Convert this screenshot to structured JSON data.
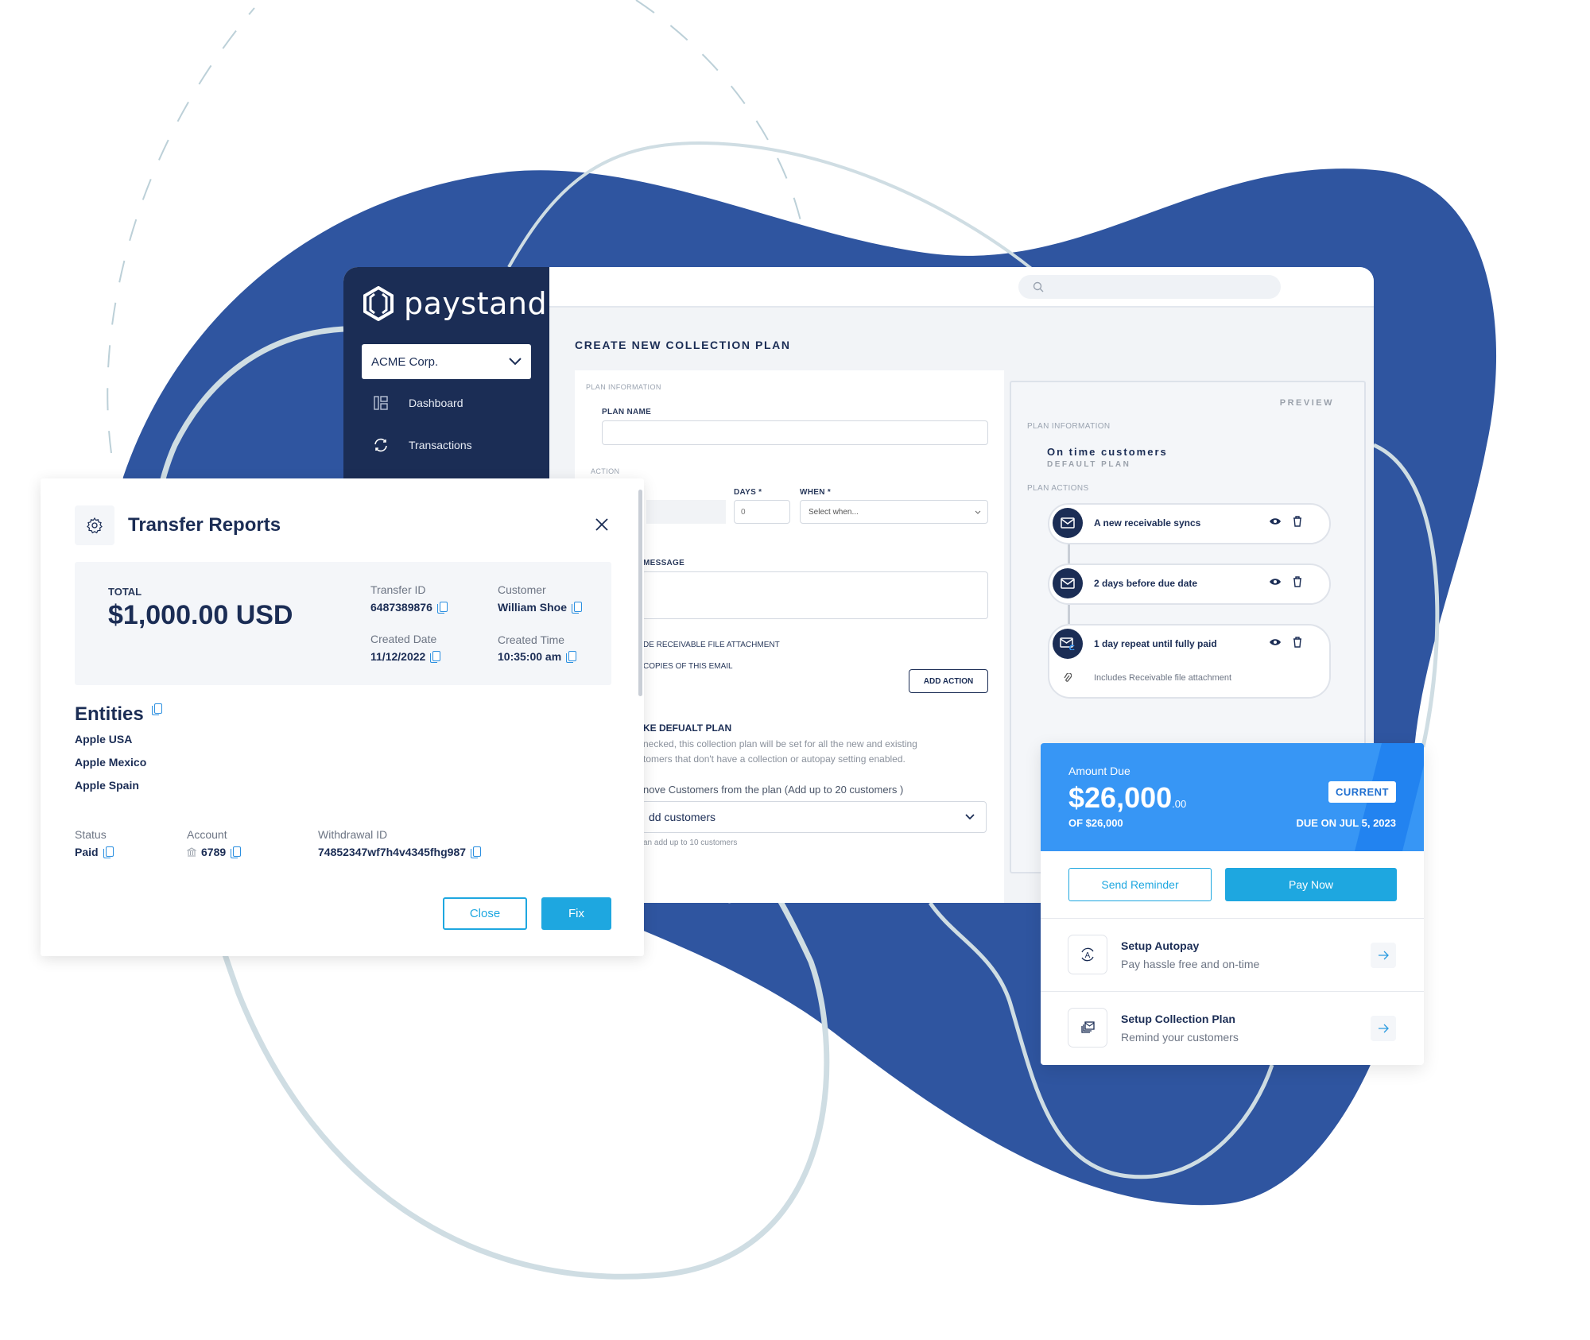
{
  "brand": {
    "name": "paystand",
    "blob_color": "#2f55a0",
    "sidebar_color": "#1b2d55",
    "accent": "#1ea7e0",
    "card_blue": "#3796f5"
  },
  "sidebar": {
    "org_select": "ACME Corp.",
    "items": [
      {
        "label": "Dashboard",
        "icon": "dashboard-icon"
      },
      {
        "label": "Transactions",
        "icon": "sync-icon"
      }
    ]
  },
  "topbar": {
    "search_placeholder": ""
  },
  "collection_plan": {
    "title": "CREATE NEW COLLECTION PLAN",
    "plan_information_label": "PLAN INFORMATION",
    "plan_name_label": "PLAN NAME",
    "plan_name_value": "",
    "action_label": "ACTION",
    "days_label": "DAYS *",
    "days_placeholder": "0",
    "when_label": "WHEN *",
    "when_placeholder": "Select when...",
    "message_label": "MESSAGE",
    "include_attachment_label": "DE RECEIVABLE FILE ATTACHMENT",
    "copies_label": "COPIES OF THIS EMAIL",
    "add_action_button": "ADD ACTION",
    "default_plan_label": "KE DEFUALT PLAN",
    "default_plan_desc_1": "necked, this collection plan will be set for all the new and existing",
    "default_plan_desc_2": "tomers that don't have a collection or autopay  setting enabled.",
    "customers_label": "nove Customers from the plan  (Add up to 20 customers )",
    "customers_select": "dd customers",
    "customers_hint": "an add up to 10 customers"
  },
  "preview": {
    "label": "PREVIEW",
    "plan_information_label": "PLAN INFORMATION",
    "plan_name": "On time customers",
    "plan_tag": "DEFAULT PLAN",
    "plan_actions_label": "PLAN ACTIONS",
    "actions": [
      {
        "title": "A new receivable syncs",
        "icon": "mail-icon"
      },
      {
        "title": "2 days before due date",
        "icon": "mail-icon"
      },
      {
        "title": "1 day repeat until fully paid",
        "icon": "mail-repeat-icon",
        "note": "Includes Receivable file attachment"
      }
    ]
  },
  "transfer_dialog": {
    "title": "Transfer Reports",
    "total_label": "TOTAL",
    "total_value": "$1,000.00 USD",
    "transfer_id_label": "Transfer ID",
    "transfer_id": "6487389876",
    "customer_label": "Customer",
    "customer": "William Shoe",
    "created_date_label": "Created Date",
    "created_date": "11/12/2022",
    "created_time_label": "Created Time",
    "created_time": "10:35:00 am",
    "entities_label": "Entities",
    "entities": [
      "Apple USA",
      "Apple Mexico",
      "Apple Spain"
    ],
    "status_label": "Status",
    "status": "Paid",
    "account_label": "Account",
    "account": "6789",
    "withdrawal_label": "Withdrawal ID",
    "withdrawal_id": "74852347wf7h4v4345fhg987",
    "close_button": "Close",
    "fix_button": "Fix"
  },
  "amount_card": {
    "label": "Amount Due",
    "amount_main": "$26,000",
    "amount_cents": ".00",
    "of_total": "OF $26,000",
    "badge": "CURRENT",
    "due": "DUE ON JUL 5, 2023",
    "send_reminder_button": "Send Reminder",
    "pay_now_button": "Pay Now",
    "rows": [
      {
        "title": "Setup Autopay",
        "subtitle": "Pay hassle free and on-time",
        "icon": "autopay-icon"
      },
      {
        "title": "Setup Collection Plan",
        "subtitle": "Remind your customers",
        "icon": "collection-plan-icon"
      }
    ]
  }
}
